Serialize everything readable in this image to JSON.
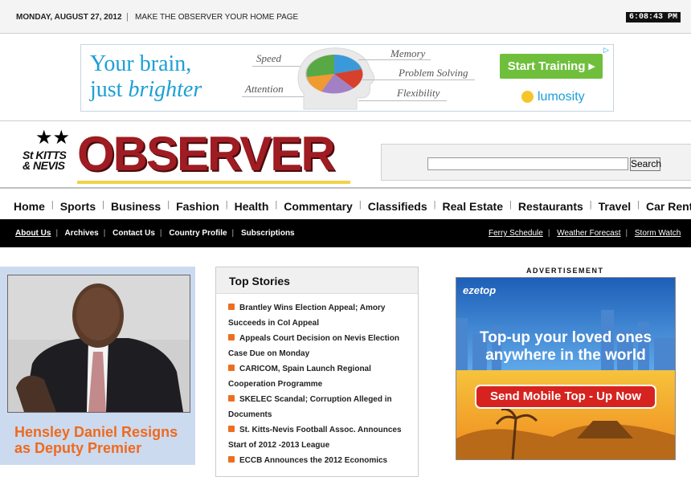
{
  "topbar": {
    "date": "MONDAY, AUGUST 27, 2012",
    "separator": "|",
    "home_link": "MAKE THE OBSERVER YOUR HOME PAGE",
    "clock": "6:08:43 PM"
  },
  "top_ad": {
    "line1": "Your brain,",
    "line2a": "just ",
    "line2b": "brighter",
    "labels": [
      "Speed",
      "Attention",
      "Memory",
      "Problem Solving",
      "Flexibility"
    ],
    "cta": "Start Training ▸",
    "brand": "lumosity",
    "adchoices": "▷"
  },
  "masthead": {
    "stkitts_line1": "St KITTS",
    "stkitts_line2": "& NEVIS",
    "logo_text": "OBSERVER",
    "search_placeholder": "",
    "search_button": "Search"
  },
  "nav": {
    "items": [
      "Home",
      "Sports",
      "Business",
      "Fashion",
      "Health",
      "Commentary",
      "Classifieds",
      "Real Estate",
      "Restaurants",
      "Travel",
      "Car Rentals"
    ]
  },
  "subnav": {
    "left": [
      "About Us",
      "Archives",
      "Contact Us",
      "Country Profile",
      "Subscriptions"
    ],
    "right": [
      "Ferry Schedule",
      "Weather Forecast",
      "Storm Watch"
    ]
  },
  "feature": {
    "headline": "Hensley Daniel Resigns as Deputy Premier"
  },
  "top_stories": {
    "title": "Top Stories",
    "items": [
      "Brantley Wins Election Appeal; Amory Succeeds in CoI Appeal",
      "Appeals Court Decision on Nevis Election Case Due on Monday",
      "CARICOM, Spain Launch Regional Cooperation Programme",
      "SKELEC Scandal; Corruption Alleged in Documents",
      "St. Kitts-Nevis Football Assoc. Announces Start of 2012 -2013 League",
      "ECCB Announces the 2012 Economics"
    ]
  },
  "side_ad": {
    "label": "ADVERTISEMENT",
    "brand": "ezetop",
    "headline1": "Top-up your loved ones",
    "headline2": "anywhere in the world",
    "cta": "Send Mobile Top - Up Now"
  },
  "colors": {
    "accent_orange": "#ec6f21",
    "logo_red": "#9e1c22",
    "feature_bg": "#ccdaf0",
    "subnav_bg": "#000000"
  }
}
